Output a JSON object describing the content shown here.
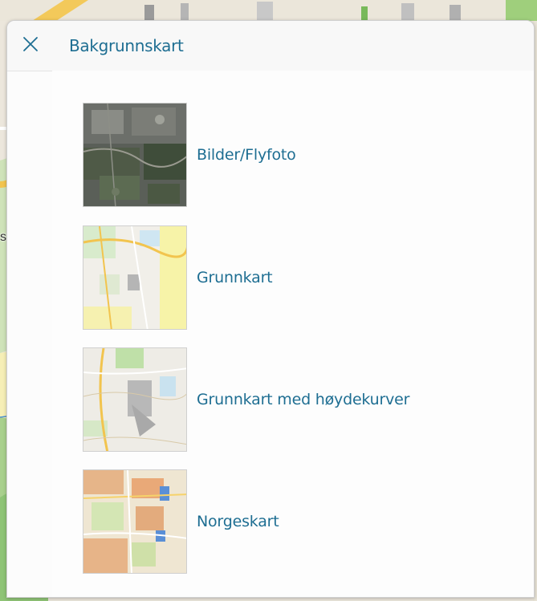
{
  "map": {
    "place_label": "skole"
  },
  "panel": {
    "title": "Bakgrunnskart",
    "close_icon": "close-icon",
    "layers": [
      {
        "label": "Bilder/Flyfoto",
        "thumbnail": "aerial-photo-thumbnail"
      },
      {
        "label": "Grunnkart",
        "thumbnail": "base-map-thumbnail"
      },
      {
        "label": "Grunnkart med høydekurver",
        "thumbnail": "base-map-contours-thumbnail"
      },
      {
        "label": "Norgeskart",
        "thumbnail": "norway-map-thumbnail"
      }
    ]
  },
  "colors": {
    "accent": "#1e6e92",
    "panel_bg": "#fcfcfc"
  }
}
